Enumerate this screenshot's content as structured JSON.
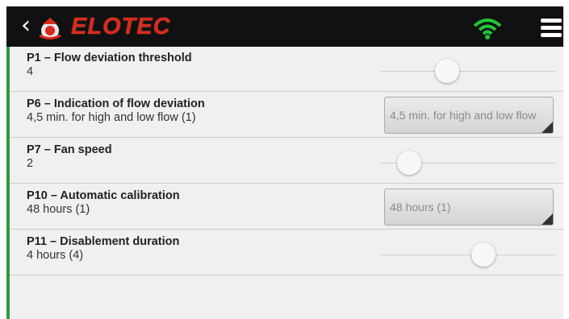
{
  "header": {
    "back_icon": "chevron-left-icon",
    "back_glyph": "‹",
    "logo_icon": "elotec-logo-icon",
    "brand": "ELOTEC",
    "wifi_icon": "wifi-icon",
    "menu_icon": "hamburger-menu-icon",
    "wifi_color": "#22c33a",
    "brand_color": "#d92b1e"
  },
  "accent_color": "#2e9b3a",
  "settings": [
    {
      "title": "P1 – Flow deviation threshold",
      "value": "4",
      "control": "slider",
      "slider_level": 0.38
    },
    {
      "title": "P6 – Indication of flow deviation",
      "value": "4,5 min. for high and low flow (1)",
      "control": "select",
      "selected": "4,5 min. for high and low flow"
    },
    {
      "title": "P7 – Fan speed",
      "value": "2",
      "control": "slider",
      "slider_level": 0.16
    },
    {
      "title": "P10 – Automatic calibration",
      "value": "48 hours (1)",
      "control": "select",
      "selected": "48 hours (1)"
    },
    {
      "title": "P11 – Disablement duration",
      "value": "4 hours (4)",
      "control": "slider",
      "slider_level": 0.59
    }
  ]
}
